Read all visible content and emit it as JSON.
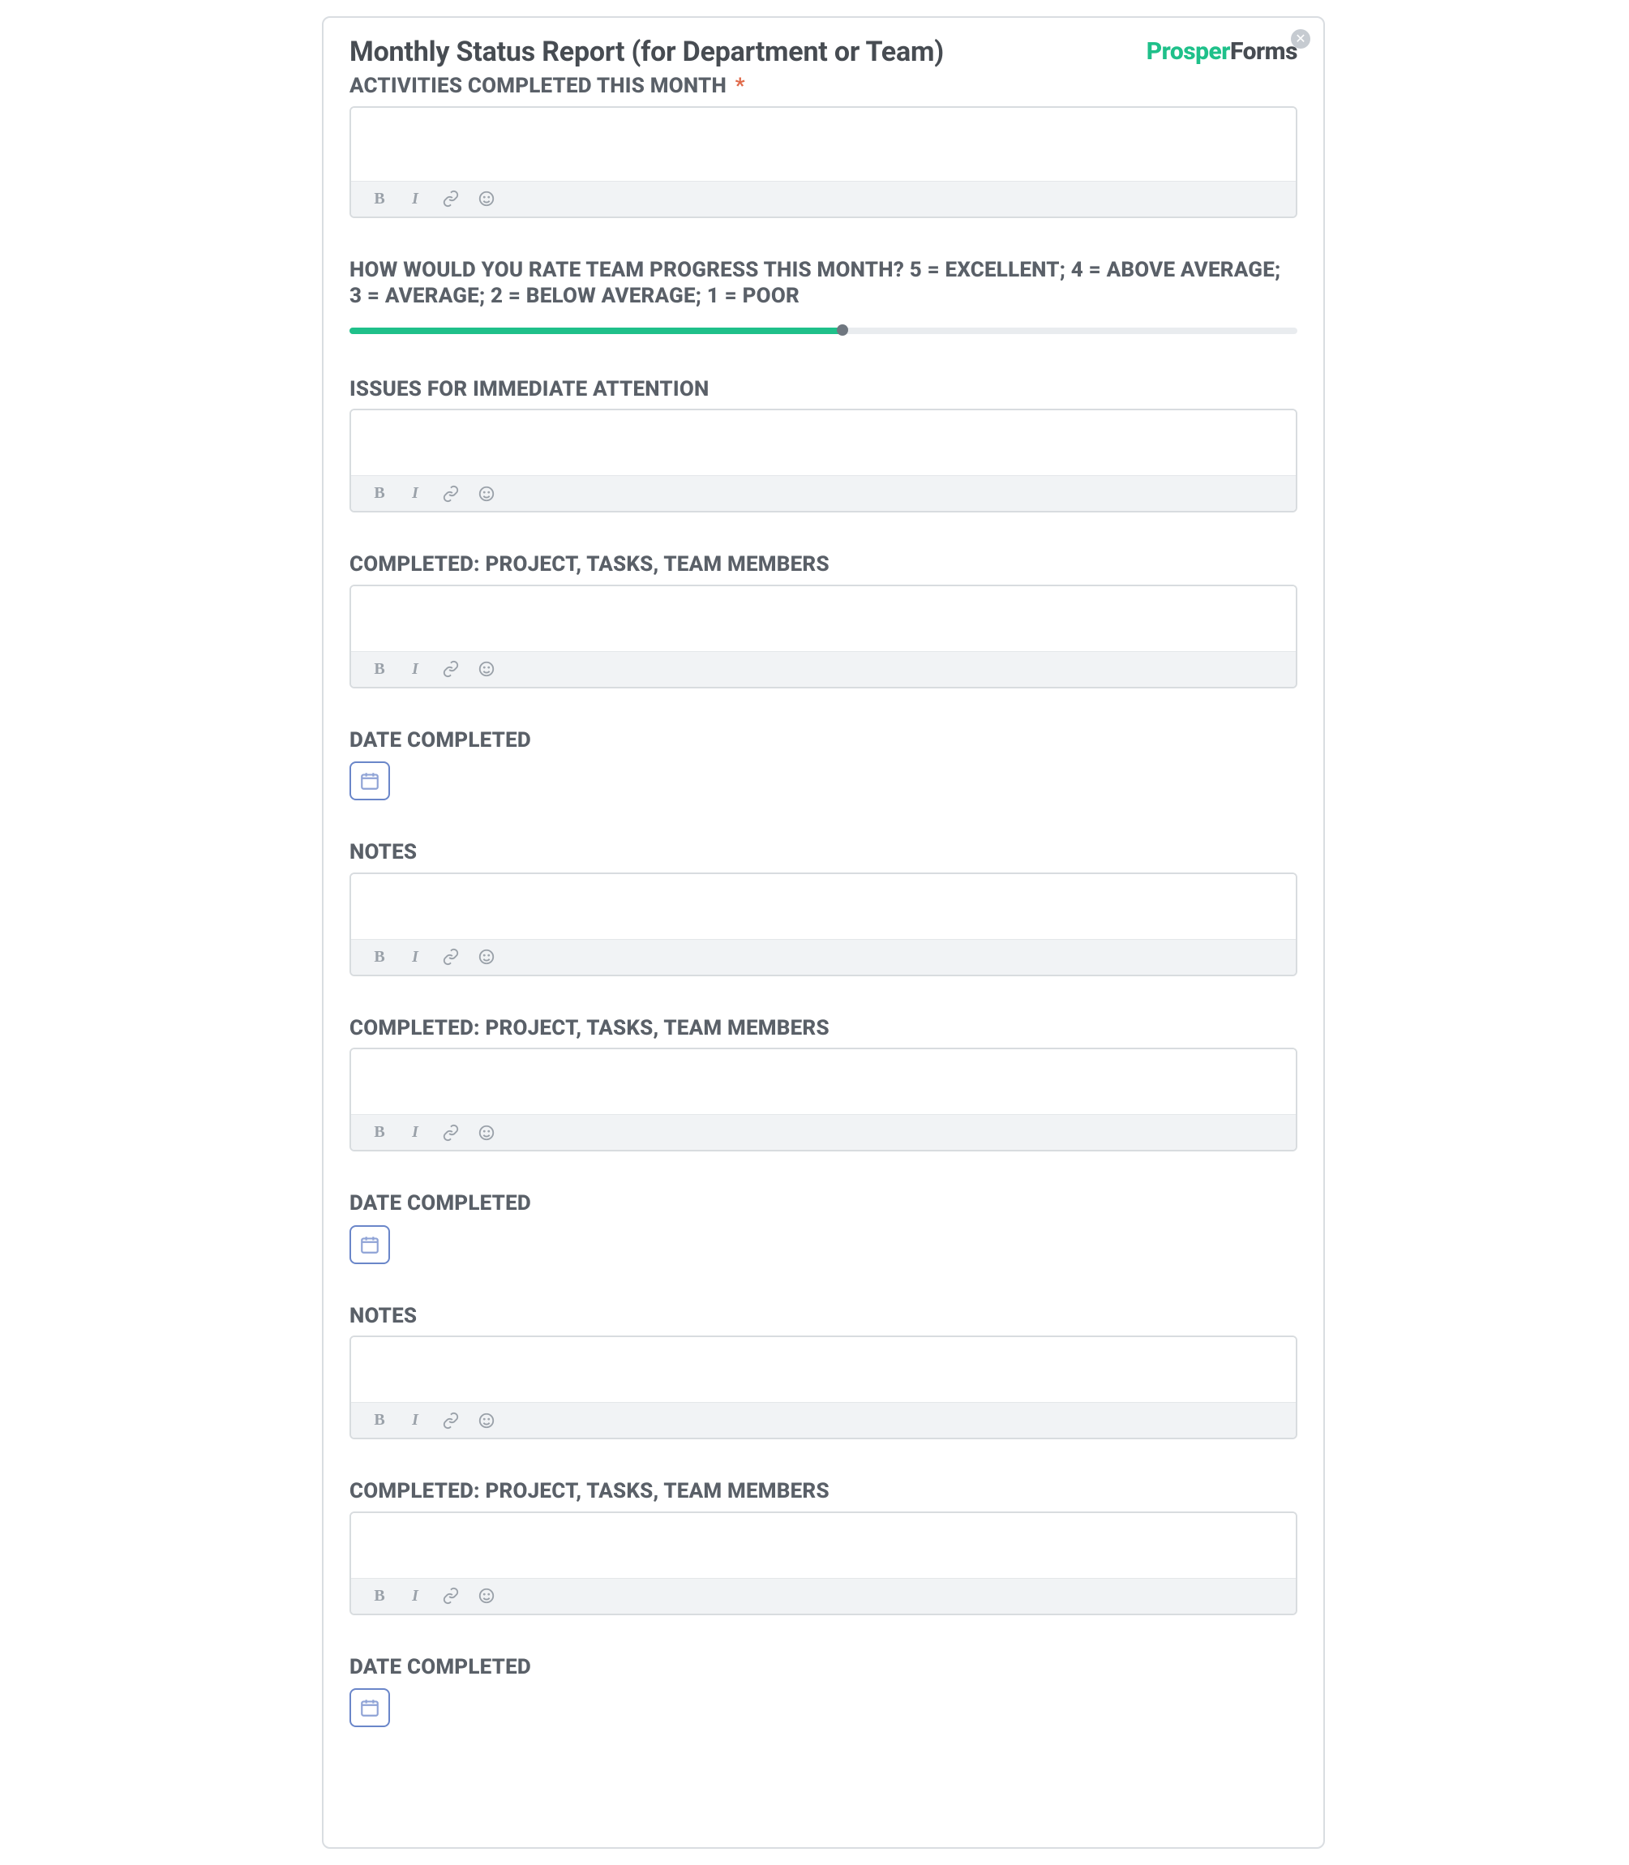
{
  "brand": {
    "part1": "Prosper",
    "part2": "Forms"
  },
  "form": {
    "title": "Monthly Status Report (for Department or Team)",
    "slider_percent": 52,
    "sections": [
      {
        "label": "ACTIVITIES COMPLETED THIS MONTH",
        "required": true,
        "type": "richtext"
      },
      {
        "label": "HOW WOULD YOU RATE TEAM PROGRESS THIS MONTH? 5 = EXCELLENT; 4 = ABOVE AVERAGE; 3 = AVERAGE; 2 = BELOW AVERAGE; 1 = POOR",
        "type": "slider"
      },
      {
        "label": "ISSUES FOR IMMEDIATE ATTENTION",
        "type": "richtext"
      },
      {
        "label": "COMPLETED: PROJECT, TASKS, TEAM MEMBERS",
        "type": "richtext"
      },
      {
        "label": "DATE COMPLETED",
        "type": "date"
      },
      {
        "label": "NOTES",
        "type": "richtext"
      },
      {
        "label": "COMPLETED: PROJECT, TASKS, TEAM MEMBERS",
        "type": "richtext"
      },
      {
        "label": "DATE COMPLETED",
        "type": "date"
      },
      {
        "label": "NOTES",
        "type": "richtext"
      },
      {
        "label": "COMPLETED: PROJECT, TASKS, TEAM MEMBERS",
        "type": "richtext"
      },
      {
        "label": "DATE COMPLETED",
        "type": "date"
      }
    ]
  },
  "toolbar": {
    "bold": "B",
    "italic": "I"
  },
  "required_marker": "*"
}
